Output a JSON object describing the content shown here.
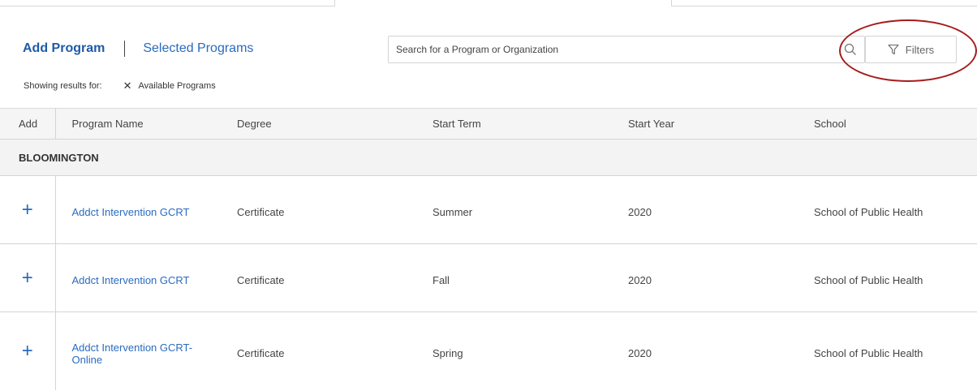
{
  "tabs": {
    "add_program": "Add Program",
    "selected_programs": "Selected Programs"
  },
  "search": {
    "placeholder": "Search for a Program or Organization",
    "icon": "search-icon"
  },
  "filters": {
    "label": "Filters",
    "icon": "filter-icon"
  },
  "results": {
    "label": "Showing results for:",
    "chip_label": "Available Programs"
  },
  "table": {
    "headers": [
      "Add",
      "Program Name",
      "Degree",
      "Start Term",
      "Start Year",
      "School"
    ],
    "group": "BLOOMINGTON",
    "rows": [
      {
        "program": "Addct Intervention GCRT",
        "degree": "Certificate",
        "term": "Summer",
        "year": "2020",
        "school": "School of Public Health"
      },
      {
        "program": "Addct Intervention GCRT",
        "degree": "Certificate",
        "term": "Fall",
        "year": "2020",
        "school": "School of Public Health"
      },
      {
        "program": "Addct Intervention GCRT-Online",
        "degree": "Certificate",
        "term": "Spring",
        "year": "2020",
        "school": "School of Public Health"
      }
    ]
  },
  "colors": {
    "accent": "#2a6bc0",
    "highlight_circle": "#a61c1c"
  }
}
